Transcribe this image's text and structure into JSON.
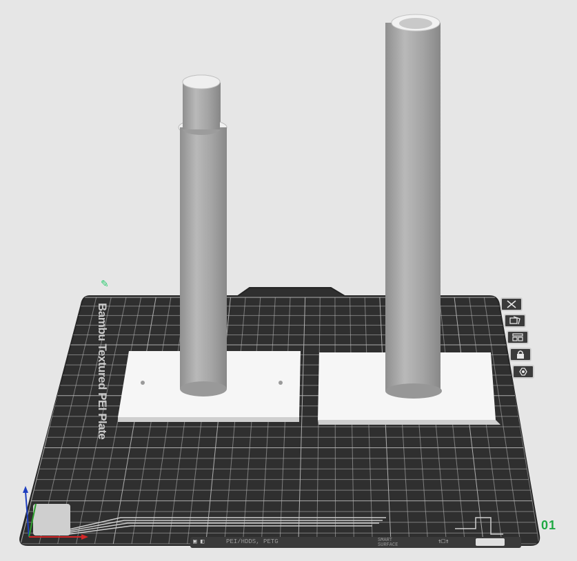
{
  "viewport": {
    "background": "#e6e6e6",
    "plate_color": "#2f2f2f",
    "grid_color": "#bdbdbd",
    "accent_green": "#1fa843",
    "object_color": "#a8a8a8"
  },
  "plate": {
    "name": "Bambu Textured PEI Plate",
    "number": "01",
    "edit_icon": "pencil-icon",
    "strip_label_left": "PEI/HDDS, PETG",
    "strip_label_right": "SMART\nSURFACE"
  },
  "plate_tools": [
    {
      "name": "close-plate-button",
      "icon": "close-icon"
    },
    {
      "name": "orient-plate-button",
      "icon": "orient-icon"
    },
    {
      "name": "arrange-plate-button",
      "icon": "arrange-icon"
    },
    {
      "name": "lock-plate-button",
      "icon": "lock-icon"
    },
    {
      "name": "plate-settings-button",
      "icon": "settings-icon"
    }
  ],
  "axes": {
    "x_color": "#d62728",
    "y_color": "#2ca02c",
    "z_color": "#1f3fbf"
  }
}
